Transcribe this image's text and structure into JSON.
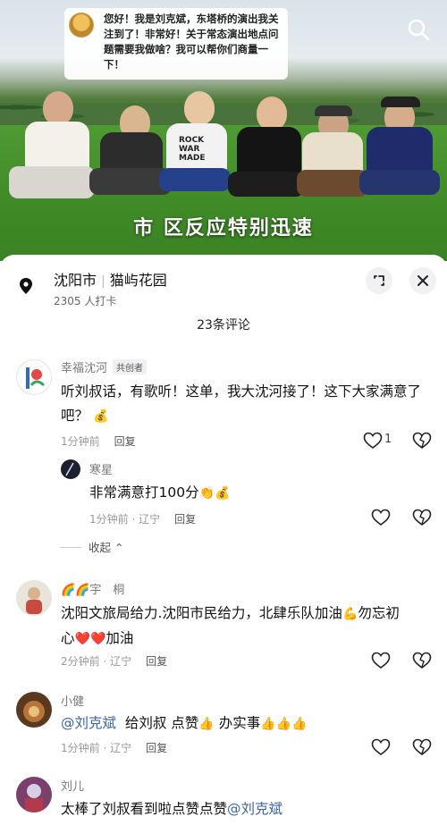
{
  "video": {
    "bubble_text": "您好！我是刘克斌，东塔桥的演出我关注到了！非常好！关于常态演出地点问题需要我做啥？我可以帮你们商量一下！",
    "caption": "市 区反应特别迅速",
    "shirt_text": "ROCK WAR MADE"
  },
  "location": {
    "city": "沈阳市",
    "place": "猫屿花园",
    "checkins": "2305 人打卡"
  },
  "comments_count": "23条评论",
  "comments": [
    {
      "name": "幸福沈河",
      "tag": "共创者",
      "text": "听刘叔话，有歌听！这单，我大沈河接了！这下大家满意了吧？",
      "emoji": "💰",
      "time": "1分钟前",
      "reply": "回复",
      "likes": "1"
    },
    {
      "name": "寒星",
      "text": "非常满意打100分",
      "emoji": "👏💰",
      "time": "1分钟前 · 辽宁",
      "reply": "回复"
    },
    {
      "name": "🌈🌈宇　桐",
      "text1": "沈阳文旅局给力.沈阳市民给力，北肆乐队加油",
      "text1_emoji": "💪",
      "text1_tail": "勿忘初",
      "text2_head": "心",
      "text2_emoji": "❤️❤️",
      "text2_tail": "加油",
      "time": "2分钟前 · 辽宁",
      "reply": "回复"
    },
    {
      "name": "小健",
      "mention": "@刘克斌",
      "text_a": "给刘叔 点赞",
      "emoji_a": "👍",
      "text_b": "办实事",
      "emoji_b": "👍👍👍",
      "time": "1分钟前 · 辽宁",
      "reply": "回复"
    },
    {
      "name": "刘儿",
      "text": "太棒了刘叔看到啦点赞点赞",
      "mention": "@刘克斌"
    }
  ],
  "collapse_label": "收起",
  "colors": {
    "mention": "#3b63a8",
    "bg": "#ffffff",
    "grass": "#3f8a27"
  }
}
